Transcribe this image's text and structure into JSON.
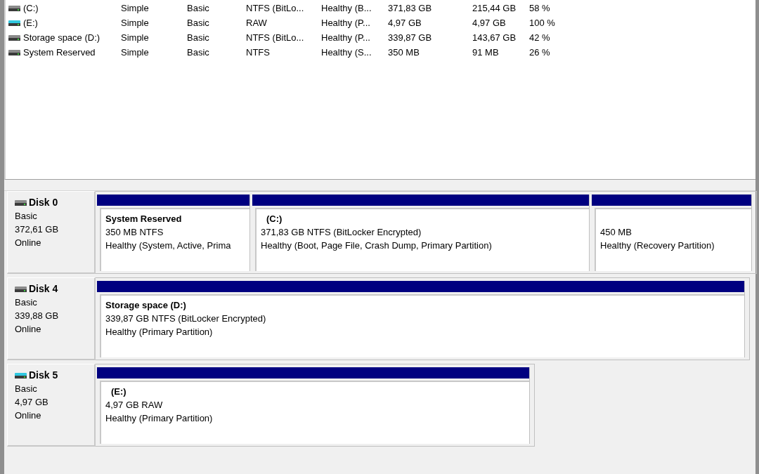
{
  "volumes": [
    {
      "name": "(C:)",
      "kind": "fixed",
      "layout": "Simple",
      "type": "Basic",
      "file_system": "NTFS (BitLo...",
      "status": "Healthy (B...",
      "capacity": "371,83 GB",
      "free_space": "215,44 GB",
      "percent_free": "58 %"
    },
    {
      "name": "(E:)",
      "kind": "removable",
      "layout": "Simple",
      "type": "Basic",
      "file_system": "RAW",
      "status": "Healthy (P...",
      "capacity": "4,97 GB",
      "free_space": "4,97 GB",
      "percent_free": "100 %"
    },
    {
      "name": "Storage space (D:)",
      "kind": "fixed",
      "layout": "Simple",
      "type": "Basic",
      "file_system": "NTFS (BitLo...",
      "status": "Healthy (P...",
      "capacity": "339,87 GB",
      "free_space": "143,67 GB",
      "percent_free": "42 %"
    },
    {
      "name": "System Reserved",
      "kind": "fixed",
      "layout": "Simple",
      "type": "Basic",
      "file_system": "NTFS",
      "status": "Healthy (S...",
      "capacity": "350 MB",
      "free_space": "91 MB",
      "percent_free": "26 %"
    }
  ],
  "disks": [
    {
      "name": "Disk 0",
      "kind": "fixed",
      "type": "Basic",
      "size": "372,61 GB",
      "status": "Online",
      "partitions": [
        {
          "name": "System Reserved",
          "details": "350 MB NTFS",
          "status": "Healthy (System, Active, Prima"
        },
        {
          "name": "(C:)",
          "details": "371,83 GB NTFS (BitLocker Encrypted)",
          "status": "Healthy (Boot, Page File, Crash Dump, Primary Partition)"
        },
        {
          "details": "450 MB",
          "status": "Healthy (Recovery Partition)"
        }
      ]
    },
    {
      "name": "Disk 4",
      "kind": "fixed",
      "type": "Basic",
      "size": "339,88 GB",
      "status": "Online",
      "partitions": [
        {
          "name": "Storage space  (D:)",
          "details": "339,87 GB NTFS (BitLocker Encrypted)",
          "status": "Healthy (Primary Partition)"
        }
      ]
    },
    {
      "name": "Disk 5",
      "kind": "removable",
      "type": "Basic",
      "size": "4,97 GB",
      "status": "Online",
      "partitions": [
        {
          "name": "(E:)",
          "details": "4,97 GB RAW",
          "status": "Healthy (Primary Partition)"
        }
      ]
    }
  ]
}
